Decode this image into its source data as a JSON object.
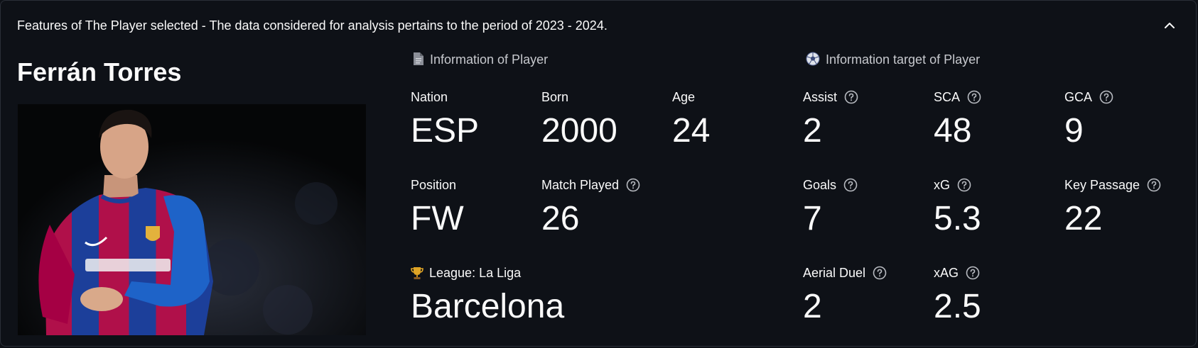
{
  "expander": {
    "title": "Features of The Player selected - The data considered for analysis pertains to the period of 2023 - 2024."
  },
  "player": {
    "name": "Ferrán Torres"
  },
  "info": {
    "header": "Information of Player",
    "nation": {
      "label": "Nation",
      "value": "ESP"
    },
    "born": {
      "label": "Born",
      "value": "2000"
    },
    "age": {
      "label": "Age",
      "value": "24"
    },
    "position": {
      "label": "Position",
      "value": "FW"
    },
    "match_played": {
      "label": "Match Played",
      "value": "26"
    },
    "league": {
      "label": "League: La Liga",
      "value": "Barcelona"
    }
  },
  "target": {
    "header": "Information target of Player",
    "assist": {
      "label": "Assist",
      "value": "2"
    },
    "sca": {
      "label": "SCA",
      "value": "48"
    },
    "gca": {
      "label": "GCA",
      "value": "9"
    },
    "goals": {
      "label": "Goals",
      "value": "7"
    },
    "xg": {
      "label": "xG",
      "value": "5.3"
    },
    "key_passage": {
      "label": "Key Passage",
      "value": "22"
    },
    "aerial_duel": {
      "label": "Aerial Duel",
      "value": "2"
    },
    "xag": {
      "label": "xAG",
      "value": "2.5"
    }
  },
  "colors": {
    "background": "#0e1117",
    "text": "#fafafa",
    "muted": "#c7c9ce",
    "jersey_red": "#a50044",
    "jersey_blue": "#1e63c8"
  },
  "icons": {
    "header_info": "document-icon",
    "header_target": "soccer-ball-icon",
    "league": "trophy-icon",
    "help": "question-circle-icon",
    "collapse": "chevron-up-icon"
  }
}
